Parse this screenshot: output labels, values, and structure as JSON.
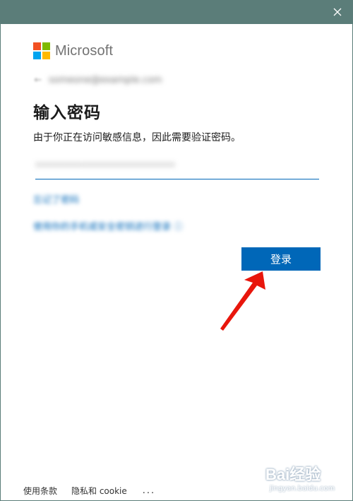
{
  "brand": {
    "name": "Microsoft",
    "colors": [
      "#f25022",
      "#7fba00",
      "#00a4ef",
      "#ffb900"
    ]
  },
  "account": {
    "email": "someone@example.com"
  },
  "page": {
    "heading": "输入密码",
    "description": "由于你正在访问敏感信息，因此需要验证密码。"
  },
  "password_field": {
    "value": "••••••••••••••••••••••••"
  },
  "links": {
    "forgot_password": "忘记了密码",
    "other_option": "使用你的手机或安全密钥进行登录 ⓘ"
  },
  "buttons": {
    "signin": "登录"
  },
  "footer": {
    "terms": "使用条款",
    "privacy": "隐私和 cookie",
    "more": "..."
  },
  "watermark": {
    "main": "Bai经验",
    "sub": "jingyan.baidu.com"
  },
  "theme": {
    "titlebar": "#5b7d79",
    "accent": "#0067b8",
    "annotation_arrow": "#e8160c"
  },
  "icons": {
    "close": "close-icon",
    "back": "back-arrow-icon",
    "arrow_annotation": "red-arrow-pointer"
  }
}
